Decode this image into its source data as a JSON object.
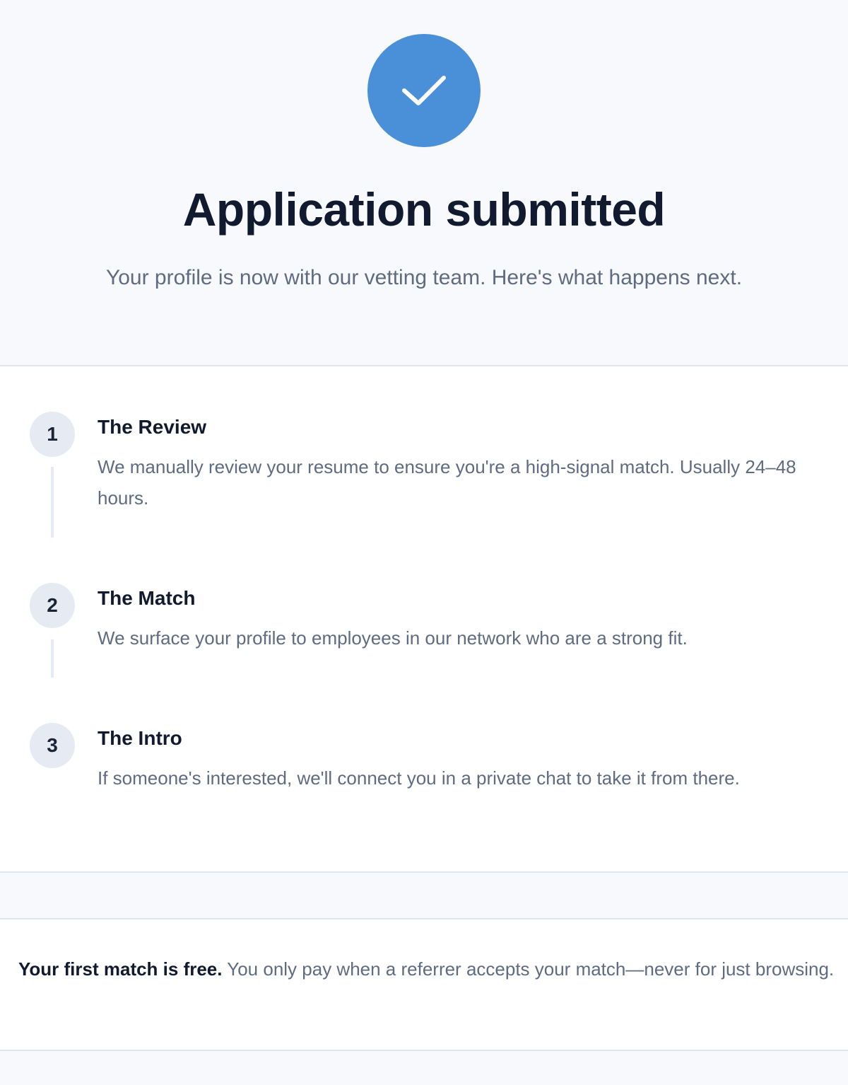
{
  "hero": {
    "icon": "check-icon",
    "accent_color": "#4a90d9",
    "title": "Application submitted",
    "subtitle": "Your profile is now with our vetting team. Here's what happens next."
  },
  "steps": [
    {
      "number": "1",
      "title": "The Review",
      "description": "We manually review your resume to ensure you're a high-signal match. Usually 24–48 hours."
    },
    {
      "number": "2",
      "title": "The Match",
      "description": "We surface your profile to employees in our network who are a strong fit."
    },
    {
      "number": "3",
      "title": "The Intro",
      "description": "If someone's interested, we'll connect you in a private chat to take it from there."
    }
  ],
  "note": {
    "strong": "Your first match is free.",
    "text": " You only pay when a referrer accepts your match—never for just browsing."
  }
}
